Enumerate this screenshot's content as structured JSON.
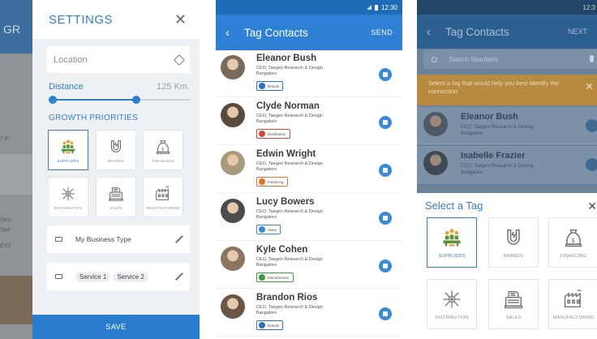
{
  "settings": {
    "background_title": "GR",
    "title": "SETTINGS",
    "close_glyph": "✕",
    "location_placeholder": "Location",
    "distance_label": "Distance",
    "distance_value": "125 Km.",
    "distance_range_fraction": [
      0.0,
      0.62
    ],
    "growth_title": "GROWTH PRIORITIES",
    "tiles": [
      {
        "label": "SUPPLIERS",
        "icon": "suppliers-icon",
        "selected": true
      },
      {
        "label": "BRANDS",
        "icon": "brands-icon",
        "selected": false
      },
      {
        "label": "FINANCING",
        "icon": "financing-icon",
        "selected": false
      },
      {
        "label": "DISTRIBUTION",
        "icon": "distribution-icon",
        "selected": false
      },
      {
        "label": "SALES",
        "icon": "sales-icon",
        "selected": false
      },
      {
        "label": "MANUFACTURING",
        "icon": "manufacturing-icon",
        "selected": false
      }
    ],
    "business_type": "My Business Type",
    "services": [
      "Service 1",
      "Service 2"
    ],
    "save_label": "SAVE",
    "background_fragments": [
      "7 R",
      "Serv",
      "Spe",
      "EX3"
    ]
  },
  "tag_contacts": {
    "status_time": "12:30",
    "back_glyph": "‹",
    "title": "Tag Contacts",
    "send_label": "SEND",
    "contacts": [
      {
        "name": "Eleanor Bush",
        "role": "CEO, Taegen Research & Design",
        "city": "Bangalore",
        "tag": "Brands",
        "tag_color": "#2d6fc0",
        "avatar_color": "#7a6a5c"
      },
      {
        "name": "Clyde Norman",
        "role": "CEO, Taegen Research & Design",
        "city": "Bangalore",
        "tag": "Distribution",
        "tag_color": "#d6453d",
        "avatar_color": "#5b4a3f"
      },
      {
        "name": "Edwin Wright",
        "role": "CEO, Taegen Research & Design",
        "city": "Bangalore",
        "tag": "Financing",
        "tag_color": "#e0742a",
        "avatar_color": "#a99a7c"
      },
      {
        "name": "Lucy Bowers",
        "role": "CEO, Taegen Research & Design",
        "city": "Bangalore",
        "tag": "Sales",
        "tag_color": "#3b8ad8",
        "avatar_color": "#4b4b4b"
      },
      {
        "name": "Kyle Cohen",
        "role": "CEO, Taegen Research & Design",
        "city": "Bangalore",
        "tag": "Manufacturer",
        "tag_color": "#3e9a3e",
        "avatar_color": "#8b7560"
      },
      {
        "name": "Brandon Rios",
        "role": "CEO, Taegen Research & Design",
        "city": "Bangalore",
        "tag": "Brands",
        "tag_color": "#2d6fc0",
        "avatar_color": "#6d5546"
      }
    ]
  },
  "select_tag": {
    "status_time": "12:3",
    "back_glyph": "‹",
    "title": "Tag Contacts",
    "next_label": "NEXT",
    "search_placeholder": "Search Members",
    "banner_text": "Select a tag that would help you best identify the connection",
    "banner_close": "✕",
    "contacts": [
      {
        "name": "Eleanor Bush",
        "role": "CEO, Taegen Research & Desing",
        "city": "Bangalore",
        "avatar_color": "#4d5a66"
      },
      {
        "name": "Isabelle Frazier",
        "role": "CEO, Taegen Research & Desing",
        "city": "Bangalore",
        "avatar_color": "#3e4a55"
      }
    ],
    "sheet_title": "Select  a Tag",
    "sheet_close": "✕",
    "tiles": [
      {
        "label": "SUPPLIERS",
        "icon": "suppliers-icon",
        "selected": true
      },
      {
        "label": "BRANDS",
        "icon": "brands-icon",
        "selected": false
      },
      {
        "label": "FINANCING",
        "icon": "financing-icon",
        "selected": false
      },
      {
        "label": "DISTRIBUTION",
        "icon": "distribution-icon",
        "selected": false
      },
      {
        "label": "SALES",
        "icon": "sales-icon",
        "selected": false
      },
      {
        "label": "MANUFACTURING",
        "icon": "manufacturing-icon",
        "selected": false
      }
    ]
  },
  "colors": {
    "primary": "#2d80d3",
    "status_bar": "#1e6bb8",
    "accent_text": "#3a7cc4",
    "suppliers_green": "#7bb35a",
    "suppliers_orange": "#e8a030"
  }
}
